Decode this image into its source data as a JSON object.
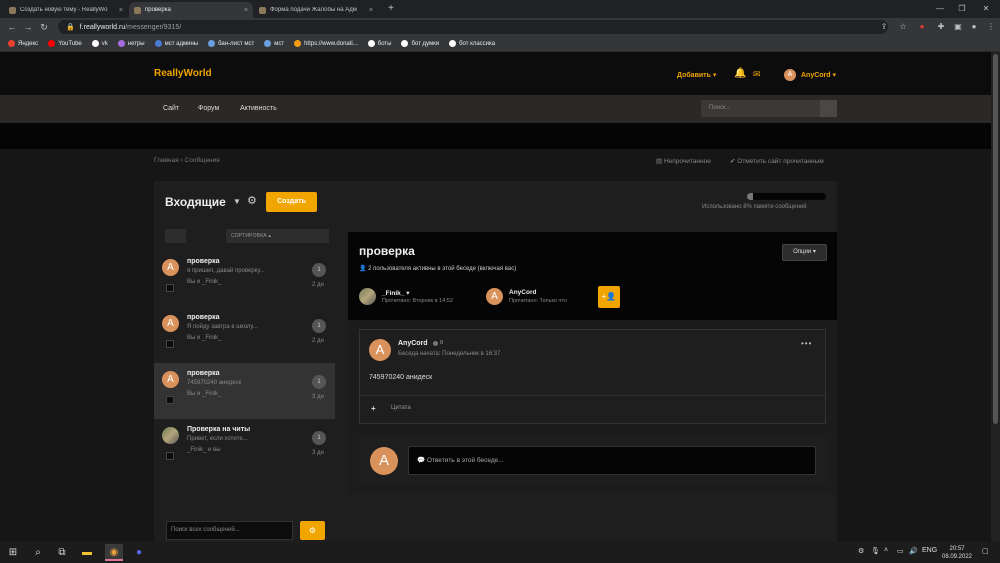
{
  "browser": {
    "tabs": [
      {
        "title": "Создать новую тему - ReallyWo",
        "close": "×"
      },
      {
        "title": "проверка",
        "close": "×"
      },
      {
        "title": "Форма подачи Жалобы на Адм",
        "close": "×"
      }
    ],
    "new_tab": "+",
    "url_host": "f.reallyworld.ru",
    "url_path": "/messenger/9315/",
    "bookmarks": [
      {
        "label": "Яндекс",
        "color": "#e9412d"
      },
      {
        "label": "YouTube",
        "color": "#ff0000"
      },
      {
        "label": "vk",
        "color": "#ffffff"
      },
      {
        "label": "нетры",
        "color": "#a96bde"
      },
      {
        "label": "мст админы",
        "color": "#4a7bd0"
      },
      {
        "label": "бан-лист мст",
        "color": "#6a9fe0"
      },
      {
        "label": "мст",
        "color": "#6a9fe0"
      },
      {
        "label": "https://www.donati...",
        "color": "#f39c12"
      },
      {
        "label": "боты",
        "color": "#ffffff"
      },
      {
        "label": "бот думки",
        "color": "#ffffff"
      },
      {
        "label": "бот классика",
        "color": "#ffffff"
      }
    ]
  },
  "site": {
    "logo": "ReallyWorld",
    "add": "Добавить ▾",
    "user_initial": "A",
    "user_name": "AnyCord ▾",
    "nav": [
      "Сайт",
      "Форум",
      "Активность"
    ],
    "search_placeholder": "Поиск...",
    "accent": "#f0a500"
  },
  "breadcrumb": "Главная  ›  Сообщения",
  "top_actions": {
    "unread": "Непрочитанное",
    "mark_read": "Отметить сайт прочитанным"
  },
  "inbox": {
    "title": "Входящие",
    "create": "Создать",
    "sort": "СОРТИРОВКА ▴",
    "search_placeholder": "Поиск всех сообщений...",
    "conversations": [
      {
        "initial": "A",
        "title": "проверка",
        "snippet": "я пришел, давай проверку...",
        "participants": "Вы и _Finik_",
        "count": "1",
        "age": "2 дн"
      },
      {
        "initial": "A",
        "title": "проверка",
        "snippet": "Я пойду завтра в школу...",
        "participants": "Вы и _Finik_",
        "count": "1",
        "age": "2 дн"
      },
      {
        "initial": "A",
        "title": "проверка",
        "snippet": "745970240 анидеск",
        "participants": "Вы и _Finik_",
        "count": "1",
        "age": "3 дн"
      },
      {
        "initial": "",
        "title": "Проверка на читы",
        "snippet": "Привет, если хотите...",
        "participants": "_Finik_ и вы",
        "count": "1",
        "age": "3 дн"
      }
    ]
  },
  "memory": {
    "label": "Использовано 8% памяти сообщений",
    "percent": 8
  },
  "conversation": {
    "title": "проверка",
    "active": "2 пользователя активны в этой беседе (включая вас)",
    "options": "Опции ▾",
    "participants": [
      {
        "name": "_Finik_ ▾",
        "status": "Прочитано: Вторник в 14:52",
        "initial": ""
      },
      {
        "name": "AnyCord",
        "status": "Прочитано: Только что",
        "initial": "A"
      }
    ],
    "invite": "+👤",
    "message": {
      "author_initial": "A",
      "author": "AnyCord",
      "online_count": "0",
      "meta": "Беседа начата: Понедельник в 16:37",
      "text": "745970240 анидеск",
      "quote": "Цитата",
      "plus": "+",
      "more": "•••"
    },
    "reply": {
      "initial": "A",
      "placeholder": "💬 Ответить в этой беседе..."
    }
  },
  "taskbar": {
    "lang": "ENG",
    "time": "20:57",
    "date": "08.09.2022"
  }
}
